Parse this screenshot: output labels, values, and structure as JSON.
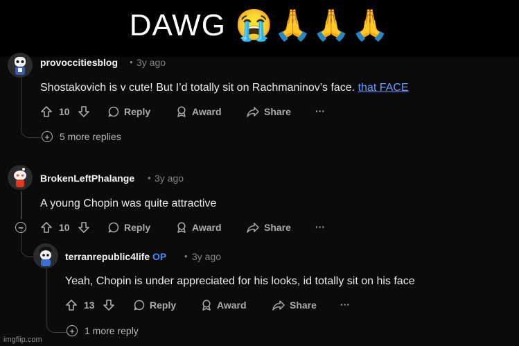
{
  "caption": {
    "text": "DAWG 😭🙏🙏🙏"
  },
  "comments": [
    {
      "username": "provoccitiesblog",
      "time": "3y ago",
      "text": "Shostakovich is v cute! But I’d totally sit on Rachmaninov’s face. ",
      "link": "that FACE",
      "votes": "10",
      "reply": "Reply",
      "award": "Award",
      "share": "Share",
      "more_replies": "5 more replies"
    },
    {
      "username": "BrokenLeftPhalange",
      "time": "3y ago",
      "text": "A young Chopin was quite attractive",
      "votes": "10",
      "reply": "Reply",
      "award": "Award",
      "share": "Share"
    },
    {
      "username": "terranrepublic4life",
      "op": "OP",
      "time": "3y ago",
      "text": "Yeah, Chopin is under appreciated for his looks, id totally sit on his face",
      "votes": "13",
      "reply": "Reply",
      "award": "Award",
      "share": "Share",
      "more_replies": "1 more reply"
    }
  ],
  "separator": "•",
  "overflow": "···",
  "watermark": "imgflip.com",
  "colors": {
    "background": "#0b0b0b",
    "link": "#6c9cff",
    "op": "#4a8cf7",
    "muted": "#818384"
  }
}
